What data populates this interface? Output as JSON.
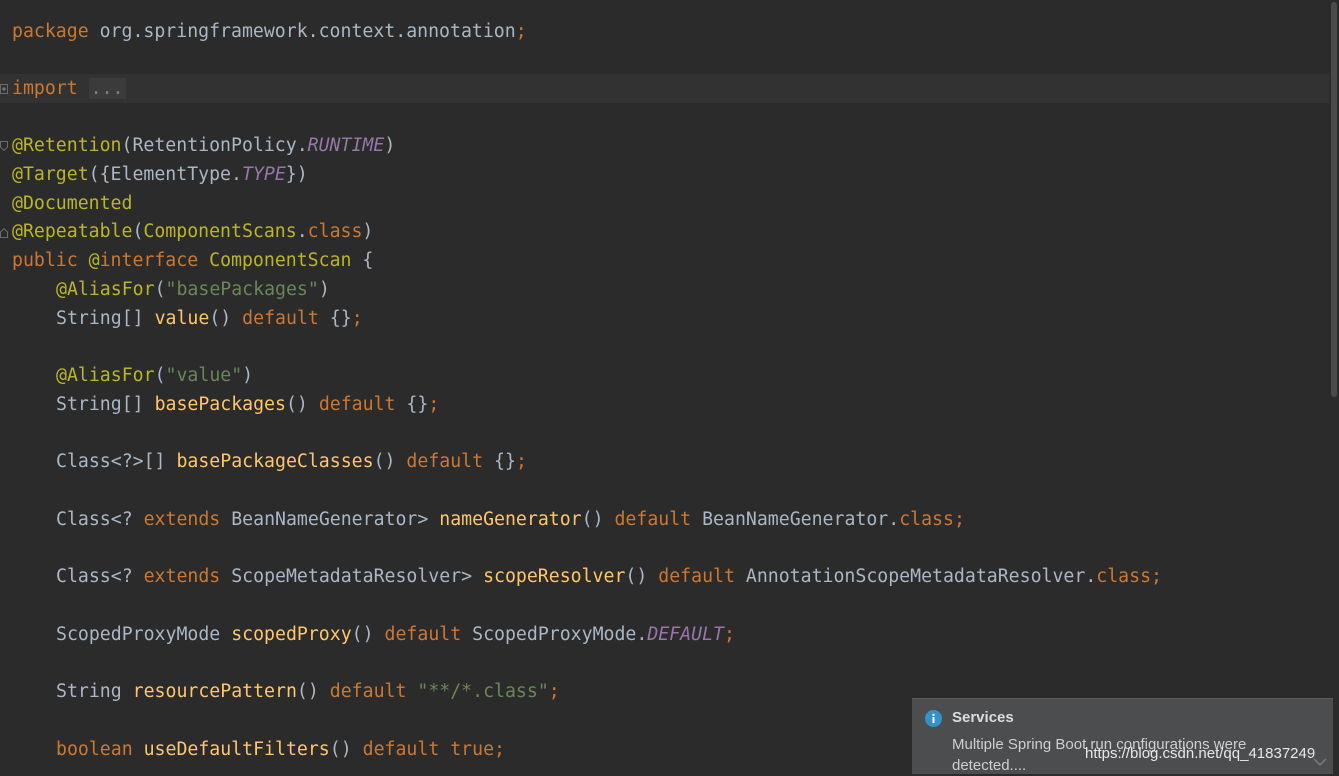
{
  "editor": {
    "line1": {
      "kw": "package",
      "pkg": " org.springframework.context.annotation",
      "semi": ";"
    },
    "line2": {
      "kw": "import",
      "ellipsis": "..."
    },
    "line3": {
      "ann": "@Retention",
      "p1": "(RetentionPolicy.",
      "const": "RUNTIME",
      "p2": ")"
    },
    "line4": {
      "ann": "@Target",
      "p1": "({ElementType.",
      "const": "TYPE",
      "p2": "})"
    },
    "line5": {
      "ann": "@Documented"
    },
    "line6": {
      "ann": "@Repeatable",
      "p1": "(",
      "cls": "ComponentScans",
      "dot": ".",
      "kw": "class",
      "p2": ")"
    },
    "line7": {
      "kw1": "public",
      "sp": " ",
      "ann": "@",
      "kw2": "interface",
      "name": " ComponentScan",
      "brace": " {"
    },
    "line8": {
      "ann": "@AliasFor",
      "p1": "(",
      "str": "\"basePackages\"",
      "p2": ")"
    },
    "line9": {
      "type": "String[] ",
      "fn": "value",
      "p1": "() ",
      "kw": "default",
      "p2": " {}",
      "semi": ";"
    },
    "line10": {
      "ann": "@AliasFor",
      "p1": "(",
      "str": "\"value\"",
      "p2": ")"
    },
    "line11": {
      "type": "String[] ",
      "fn": "basePackages",
      "p1": "() ",
      "kw": "default",
      "p2": " {}",
      "semi": ";"
    },
    "line12": {
      "type": "Class<?>[] ",
      "fn": "basePackageClasses",
      "p1": "() ",
      "kw": "default",
      "p2": " {}",
      "semi": ";"
    },
    "line13": {
      "t1": "Class<? ",
      "ext": "extends",
      "t2": " BeanNameGenerator> ",
      "fn": "nameGenerator",
      "p1": "() ",
      "kw": "default",
      "t3": " BeanNameGenerator.",
      "cls": "class",
      "semi": ";"
    },
    "line14": {
      "t1": "Class<? ",
      "ext": "extends",
      "t2": " ScopeMetadataResolver> ",
      "fn": "scopeResolver",
      "p1": "() ",
      "kw": "default",
      "t3": " AnnotationScopeMetadataResolver.",
      "cls": "class",
      "semi": ";"
    },
    "line15": {
      "type": "ScopedProxyMode ",
      "fn": "scopedProxy",
      "p1": "() ",
      "kw": "default",
      "t3": " ScopedProxyMode.",
      "const": "DEFAULT",
      "semi": ";"
    },
    "line16": {
      "type": "String ",
      "fn": "resourcePattern",
      "p1": "() ",
      "kw": "default",
      "sp": " ",
      "str": "\"**/*.class\"",
      "semi": ";"
    },
    "line17": {
      "type": "boolean",
      "sp1": " ",
      "fn": "useDefaultFilters",
      "p1": "() ",
      "kw": "default",
      "sp2": " ",
      "val": "true",
      "semi": ";"
    }
  },
  "notification": {
    "icon": "info-icon",
    "title": "Services",
    "body": "Multiple Spring Boot run configurations were detected...."
  },
  "watermark": "https://blog.csdn.net/qq_41837249",
  "colors": {
    "background": "#2b2b2b",
    "keyword": "#cc7832",
    "annotation": "#bbb529",
    "method": "#ffc66d",
    "string": "#6a8759",
    "constant": "#9876aa",
    "text": "#a9b7c6"
  }
}
